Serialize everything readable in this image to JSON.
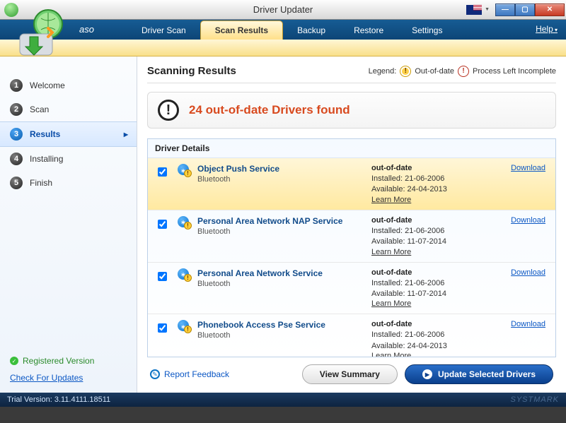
{
  "window": {
    "title": "Driver Updater",
    "brand_suffix": "aso"
  },
  "menubar": {
    "tabs": [
      "Driver Scan",
      "Scan Results",
      "Backup",
      "Restore",
      "Settings"
    ],
    "active_index": 1,
    "help": "Help"
  },
  "sidebar": {
    "steps": [
      {
        "num": "1",
        "label": "Welcome"
      },
      {
        "num": "2",
        "label": "Scan"
      },
      {
        "num": "3",
        "label": "Results"
      },
      {
        "num": "4",
        "label": "Installing"
      },
      {
        "num": "5",
        "label": "Finish"
      }
    ],
    "active_index": 2,
    "registered": "Registered Version",
    "check_updates": "Check For Updates"
  },
  "content": {
    "heading": "Scanning Results",
    "legend_label": "Legend:",
    "legend_out_of_date": "Out-of-date",
    "legend_incomplete": "Process Left Incomplete",
    "banner": "24 out-of-date Drivers found",
    "details_header": "Driver Details",
    "status_label": "out-of-date",
    "download_label": "Download",
    "learn_more_label": "Learn More",
    "drivers": [
      {
        "name": "Object Push Service",
        "category": "Bluetooth",
        "installed": "Installed: 21-06-2006",
        "available": "Available: 24-04-2013",
        "highlight": true
      },
      {
        "name": "Personal Area Network NAP Service",
        "category": "Bluetooth",
        "installed": "Installed: 21-06-2006",
        "available": "Available: 11-07-2014",
        "highlight": false
      },
      {
        "name": "Personal Area Network Service",
        "category": "Bluetooth",
        "installed": "Installed: 21-06-2006",
        "available": "Available: 11-07-2014",
        "highlight": false
      },
      {
        "name": "Phonebook Access Pse Service",
        "category": "Bluetooth",
        "installed": "Installed: 21-06-2006",
        "available": "Available: 24-04-2013",
        "highlight": false
      }
    ]
  },
  "footer": {
    "report": "Report Feedback",
    "view_summary": "View Summary",
    "update_selected": "Update Selected Drivers"
  },
  "statusbar": {
    "version": "Trial Version: 3.11.4111.18511",
    "watermark": "SYSTMARK"
  }
}
